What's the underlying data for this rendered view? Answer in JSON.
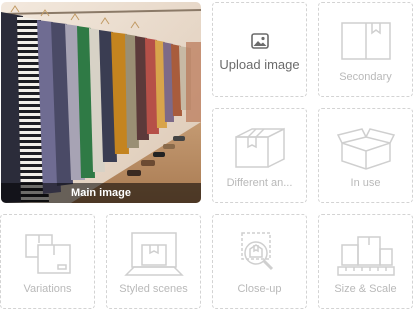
{
  "main": {
    "caption": "Main image"
  },
  "upload": {
    "label": "Upload image",
    "icon": "image-icon"
  },
  "slots": [
    {
      "label": "Secondary",
      "icon": "box-flat-icon"
    },
    {
      "label": "Different an...",
      "icon": "box-angle-icon"
    },
    {
      "label": "In use",
      "icon": "box-open-icon"
    },
    {
      "label": "Variations",
      "icon": "boxes-icon"
    },
    {
      "label": "Styled scenes",
      "icon": "box-scene-icon"
    },
    {
      "label": "Close-up",
      "icon": "magnifier-icon"
    },
    {
      "label": "Size & Scale",
      "icon": "ruler-boxes-icon"
    }
  ],
  "colors": {
    "placeholder_stroke": "#cfcfcf",
    "caption_bg": "#000000",
    "upload_text": "#6b6b6b"
  }
}
